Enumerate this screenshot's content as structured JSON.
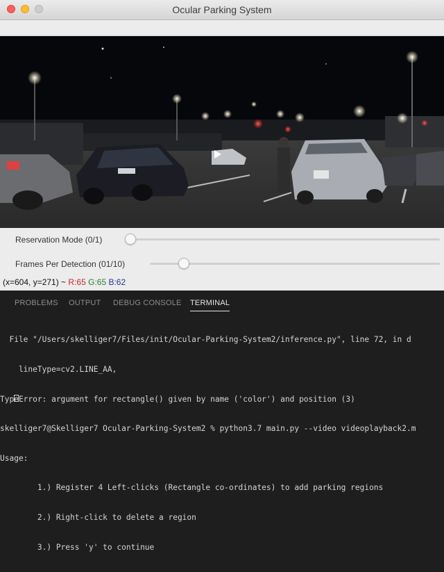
{
  "window": {
    "title": "Ocular Parking System"
  },
  "controls": {
    "reservation_label": "Reservation Mode (0/1)",
    "reservation_value": 0,
    "reservation_max": 1,
    "frames_label": "Frames Per Detection (01/10)",
    "frames_value": 1,
    "frames_max": 10
  },
  "status": {
    "coords": "(x=604, y=271) ~",
    "r": "R:65",
    "g": "G:65",
    "b": "B:62"
  },
  "panel": {
    "tabs": [
      "PROBLEMS",
      "OUTPUT",
      "DEBUG CONSOLE",
      "TERMINAL"
    ],
    "active_tab": "TERMINAL",
    "terminal_lines": [
      "  File \"/Users/skelliger7/Files/init/Ocular-Parking-System2/inference.py\", line 72, in d",
      "    lineType=cv2.LINE_AA,",
      "TypeError: argument for rectangle() given by name ('color') and position (3)",
      "skelliger7@Skelliger7 Ocular-Parking-System2 % python3.7 main.py --video videoplayback2.m",
      "Usage:",
      "        1.) Register 4 Left-clicks (Rectangle co-ordinates) to add parking regions",
      "        2.) Right-click to delete a region",
      "        3.) Press 'y' to continue"
    ]
  },
  "colors": {
    "status_r": "#c62828",
    "status_g": "#2e7d32",
    "status_b": "#283593",
    "terminal_bg": "#1e1e1e"
  }
}
